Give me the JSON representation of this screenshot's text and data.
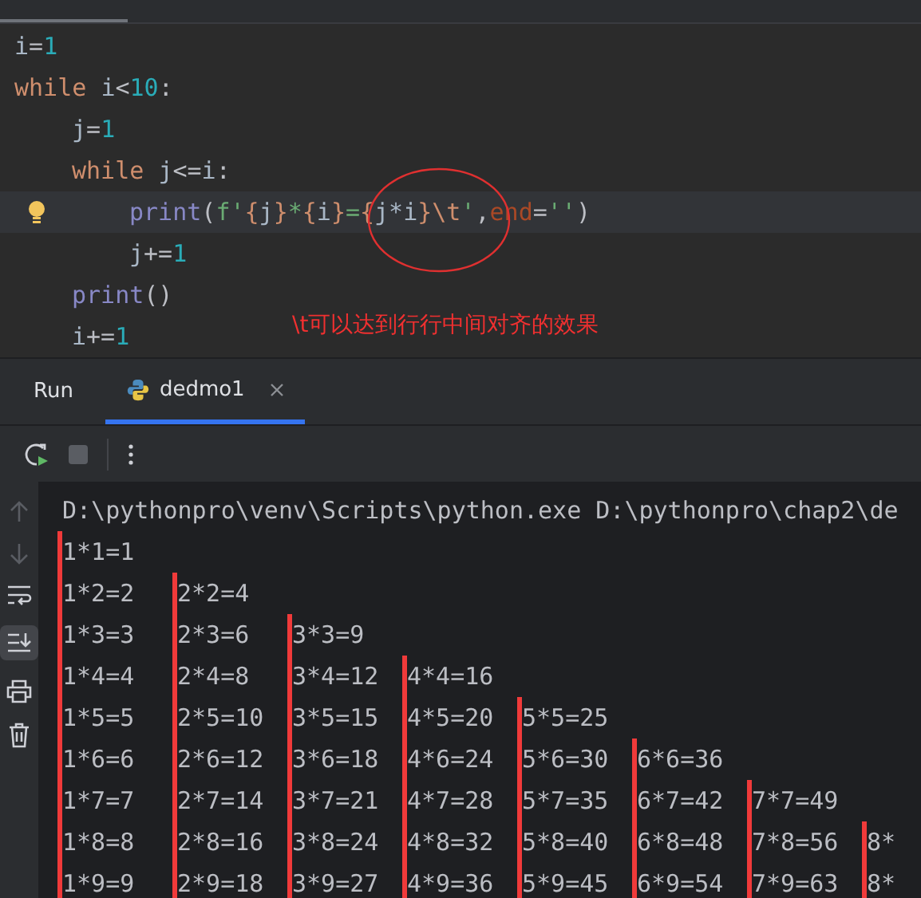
{
  "editor": {
    "lines": [
      {
        "tokens": [
          {
            "text": "i",
            "kind": "name"
          },
          {
            "text": "=",
            "kind": "plain"
          },
          {
            "text": "1",
            "kind": "number"
          }
        ]
      },
      {
        "tokens": [
          {
            "text": "while ",
            "kind": "keyword"
          },
          {
            "text": "i",
            "kind": "name"
          },
          {
            "text": "<",
            "kind": "plain"
          },
          {
            "text": "10",
            "kind": "number"
          },
          {
            "text": ":",
            "kind": "plain"
          }
        ],
        "children": [
          {
            "tokens": [
              {
                "text": "j",
                "kind": "name"
              },
              {
                "text": "=",
                "kind": "plain"
              },
              {
                "text": "1",
                "kind": "number"
              }
            ]
          },
          {
            "tokens": [
              {
                "text": "while ",
                "kind": "keyword"
              },
              {
                "text": "j",
                "kind": "name"
              },
              {
                "text": "<=",
                "kind": "plain"
              },
              {
                "text": "i",
                "kind": "name"
              },
              {
                "text": ":",
                "kind": "plain"
              }
            ],
            "children": [
              {
                "current": true,
                "tokens": [
                  {
                    "text": "print",
                    "kind": "builtin"
                  },
                  {
                    "text": "(",
                    "kind": "plain"
                  },
                  {
                    "text": "f'",
                    "kind": "string"
                  },
                  {
                    "text": "{",
                    "kind": "brace"
                  },
                  {
                    "text": "j",
                    "kind": "name"
                  },
                  {
                    "text": "}",
                    "kind": "brace"
                  },
                  {
                    "text": "*",
                    "kind": "string"
                  },
                  {
                    "text": "{",
                    "kind": "brace"
                  },
                  {
                    "text": "i",
                    "kind": "name"
                  },
                  {
                    "text": "}",
                    "kind": "brace"
                  },
                  {
                    "text": "=",
                    "kind": "string"
                  },
                  {
                    "text": "{",
                    "kind": "brace"
                  },
                  {
                    "text": "j*i",
                    "kind": "name"
                  },
                  {
                    "text": "}",
                    "kind": "brace"
                  },
                  {
                    "text": "\\t",
                    "kind": "brace"
                  },
                  {
                    "text": "'",
                    "kind": "string"
                  },
                  {
                    "text": ",",
                    "kind": "plain"
                  },
                  {
                    "text": "end",
                    "kind": "param"
                  },
                  {
                    "text": "=",
                    "kind": "plain"
                  },
                  {
                    "text": "''",
                    "kind": "string"
                  },
                  {
                    "text": ")",
                    "kind": "plain"
                  }
                ]
              },
              {
                "tokens": [
                  {
                    "text": "j",
                    "kind": "name"
                  },
                  {
                    "text": "+=",
                    "kind": "plain"
                  },
                  {
                    "text": "1",
                    "kind": "number"
                  }
                ]
              }
            ]
          },
          {
            "tokens": [
              {
                "text": "print",
                "kind": "builtin"
              },
              {
                "text": "()",
                "kind": "plain"
              }
            ]
          },
          {
            "tokens": [
              {
                "text": "i",
                "kind": "name"
              },
              {
                "text": "+=",
                "kind": "plain"
              },
              {
                "text": "1",
                "kind": "number"
              }
            ]
          }
        ]
      }
    ],
    "annotation": "\\t可以达到行行中间对齐的效果"
  },
  "run_panel": {
    "title": "Run",
    "tabs": [
      {
        "label": "dedmo1",
        "selected": true
      }
    ],
    "command": "D:\\pythonpro\\venv\\Scripts\\python.exe D:\\pythonpro\\chap2\\de",
    "output_marked": true,
    "output": [
      [
        "1*1=1"
      ],
      [
        "1*2=2",
        "2*2=4"
      ],
      [
        "1*3=3",
        "2*3=6",
        "3*3=9"
      ],
      [
        "1*4=4",
        "2*4=8",
        "3*4=12",
        "4*4=16"
      ],
      [
        "1*5=5",
        "2*5=10",
        "3*5=15",
        "4*5=20",
        "5*5=25"
      ],
      [
        "1*6=6",
        "2*6=12",
        "3*6=18",
        "4*6=24",
        "5*6=30",
        "6*6=36"
      ],
      [
        "1*7=7",
        "2*7=14",
        "3*7=21",
        "4*7=28",
        "5*7=35",
        "6*7=42",
        "7*7=49"
      ],
      [
        "1*8=8",
        "2*8=16",
        "3*8=24",
        "4*8=32",
        "5*8=40",
        "6*8=48",
        "7*8=56",
        "8*"
      ],
      [
        "1*9=9",
        "2*9=18",
        "3*9=27",
        "4*9=36",
        "5*9=45",
        "6*9=54",
        "7*9=63",
        "8*"
      ]
    ]
  }
}
